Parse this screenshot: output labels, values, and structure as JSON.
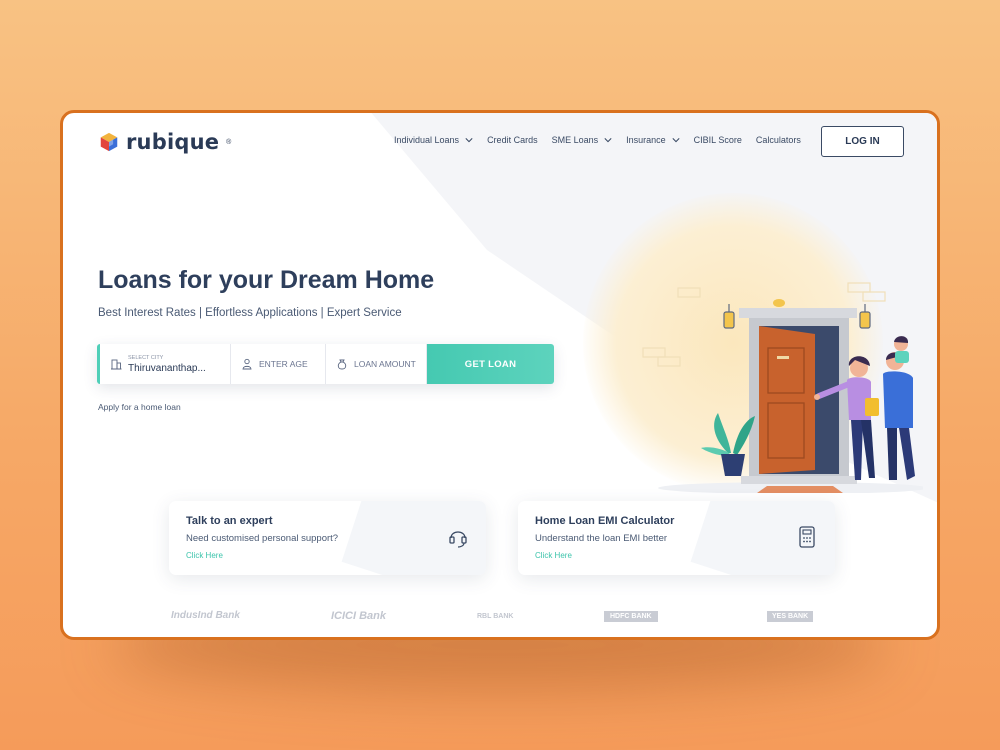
{
  "brand": {
    "name": "rubique",
    "reg_mark": "®"
  },
  "nav": {
    "items": [
      {
        "label": "Individual Loans",
        "has_dropdown": true
      },
      {
        "label": "Credit Cards",
        "has_dropdown": false
      },
      {
        "label": "SME Loans",
        "has_dropdown": true
      },
      {
        "label": "Insurance",
        "has_dropdown": true
      },
      {
        "label": "CIBIL Score",
        "has_dropdown": false
      },
      {
        "label": "Calculators",
        "has_dropdown": false
      }
    ],
    "login_label": "LOG IN"
  },
  "hero": {
    "title": "Loans for your Dream Home",
    "subtitle": "Best Interest Rates | Effortless Applications | Expert Service",
    "search": {
      "city_label": "SELECT CITY",
      "city_value": "Thiruvananthap...",
      "age_placeholder": "ENTER AGE",
      "amount_placeholder": "LOAN AMOUNT",
      "cta_label": "GET LOAN"
    },
    "apply_link": "Apply for a home loan"
  },
  "cards": [
    {
      "title": "Talk to an expert",
      "description": "Need customised personal support?",
      "link": "Click Here",
      "icon": "headset-icon"
    },
    {
      "title": "Home Loan EMI Calculator",
      "description": "Understand the loan EMI better",
      "link": "Click Here",
      "icon": "calculator-icon"
    }
  ],
  "partner_banks": [
    "IndusInd Bank",
    "ICICI Bank",
    "RBL BANK",
    "HDFC BANK",
    "YES BANK"
  ],
  "colors": {
    "accent": "#4fcfb8",
    "text_dark": "#2e3f5c",
    "frame_border": "#d9711f",
    "background": "#f6a866"
  }
}
